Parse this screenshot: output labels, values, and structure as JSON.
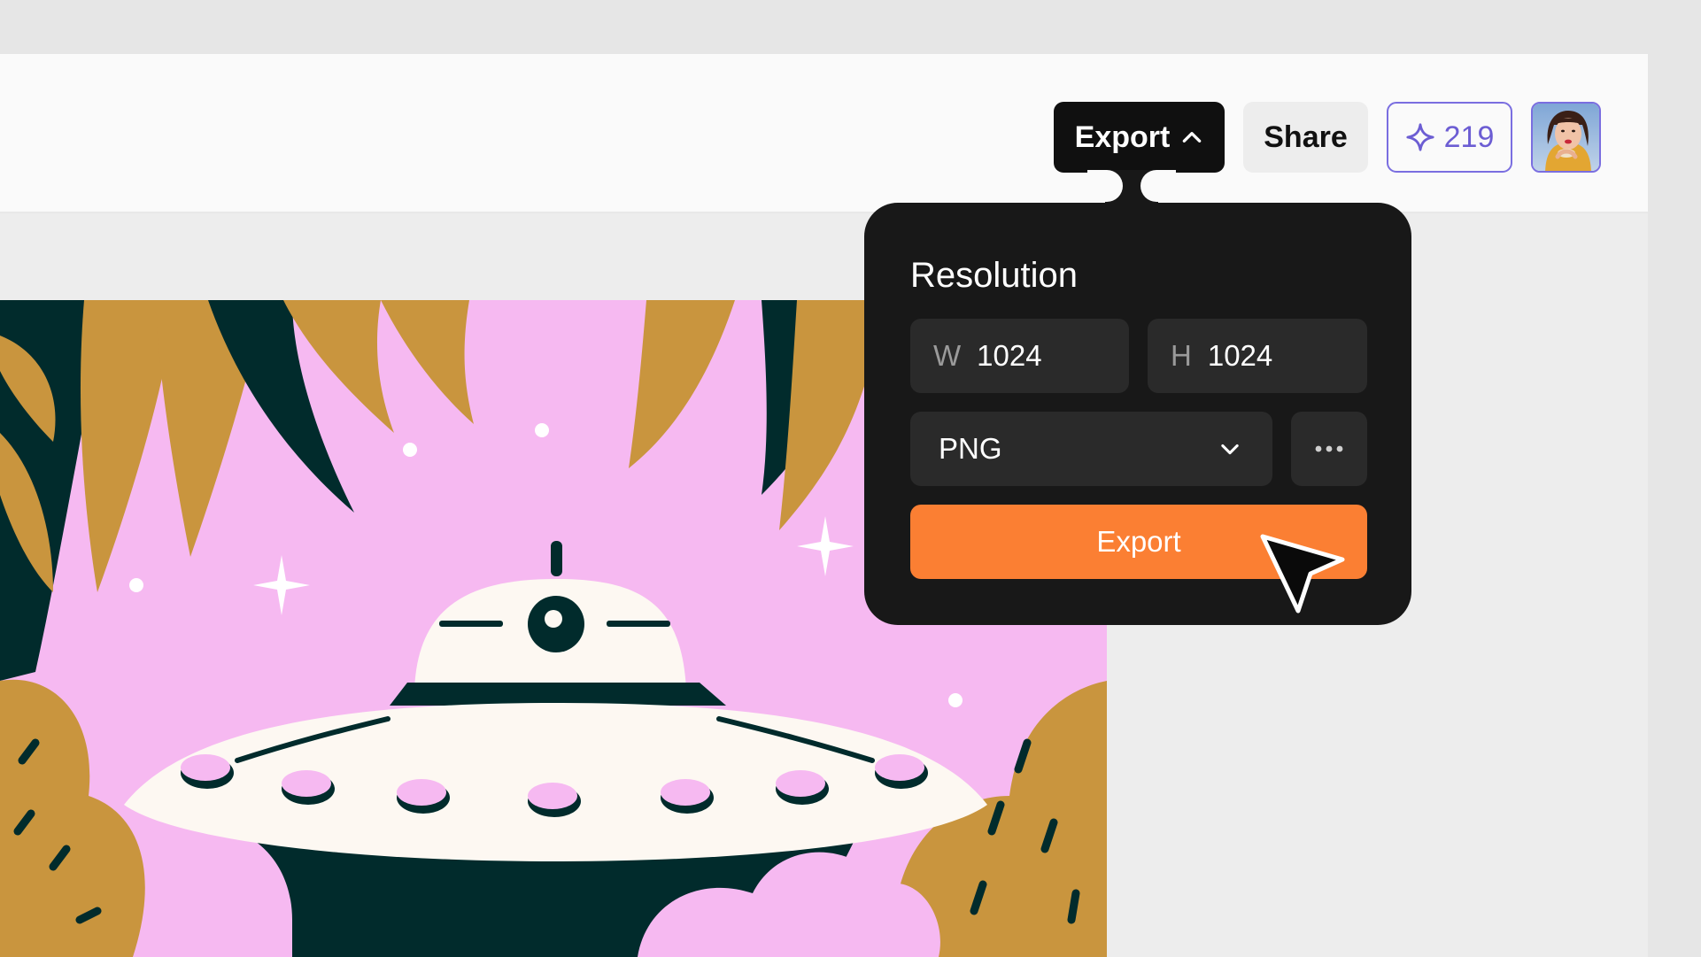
{
  "header": {
    "export_label": "Export",
    "share_label": "Share",
    "credits_count": "219"
  },
  "export_popover": {
    "title": "Resolution",
    "width_prefix": "W",
    "width_value": "1024",
    "height_prefix": "H",
    "height_value": "1024",
    "format_selected": "PNG",
    "export_button_label": "Export"
  },
  "colors": {
    "accent_orange": "#fb7f33",
    "credits_purple": "#6c5dd3",
    "popover_bg": "#181818",
    "art_pink": "#f6b9f1",
    "art_dark_green": "#012b2c",
    "art_mustard": "#c9953e",
    "art_cream": "#fdf8f2"
  },
  "icons": {
    "export_toggle": "chevron-up-icon",
    "credits": "sparkle-icon",
    "format_select": "chevron-down-icon",
    "more": "more-horizontal-icon",
    "pointer": "cursor-arrow-icon"
  }
}
